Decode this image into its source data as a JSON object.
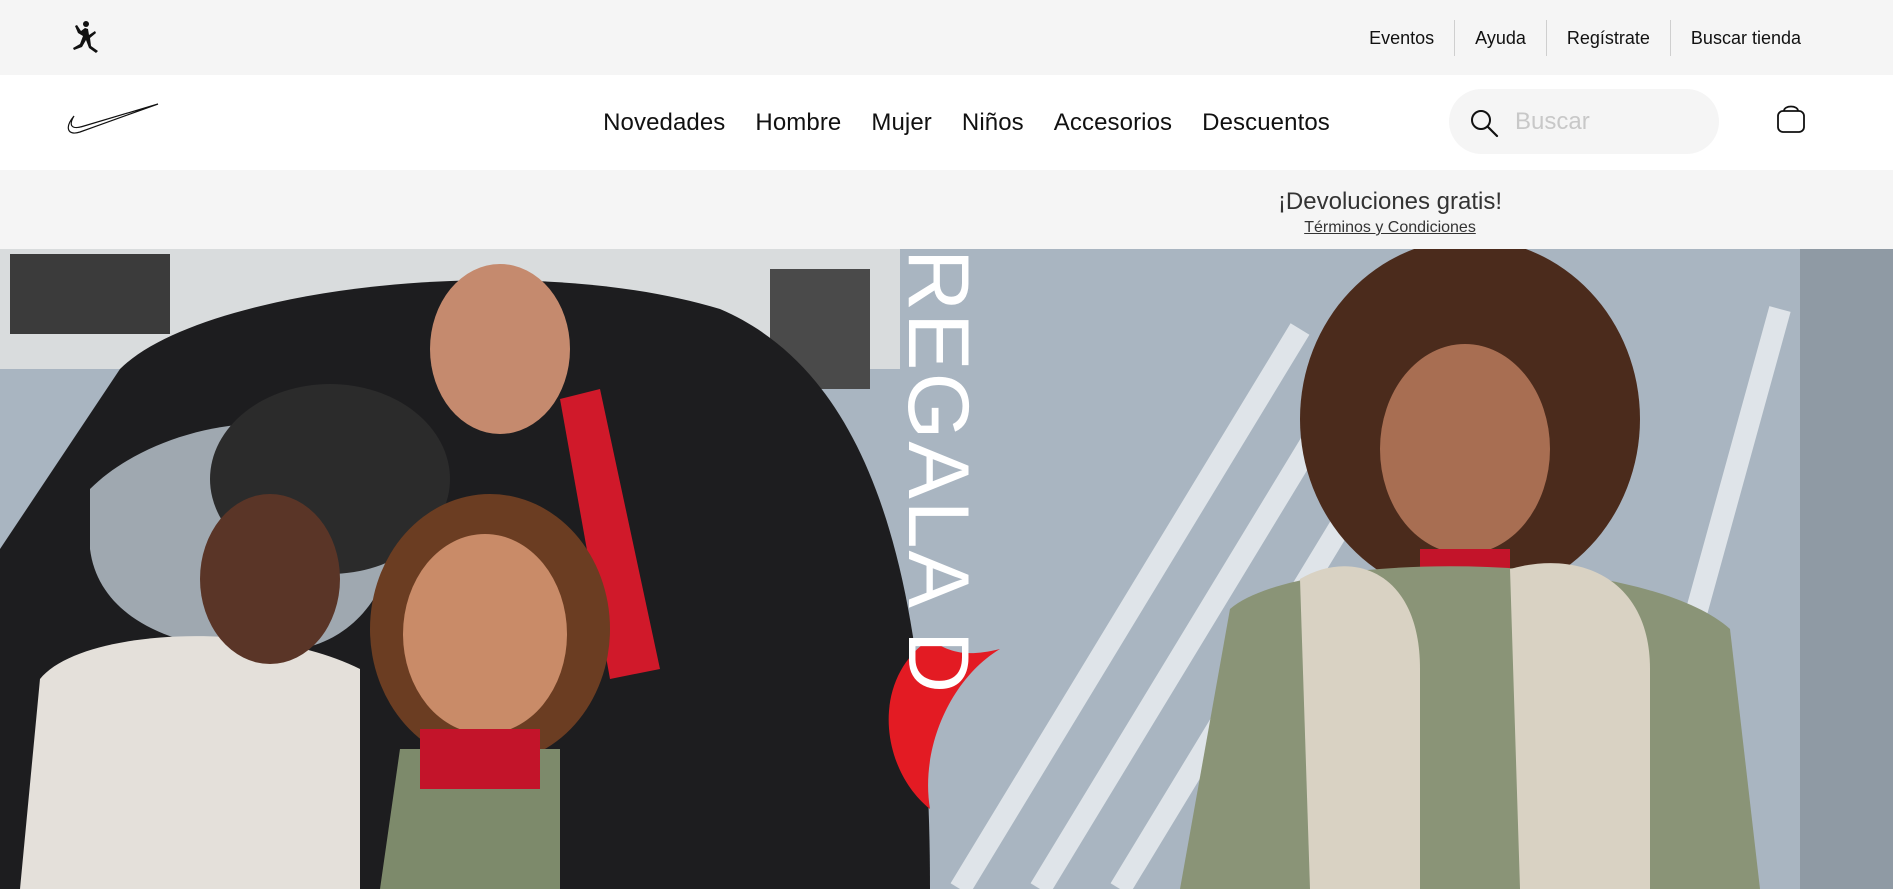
{
  "utility": {
    "logo_icon": "jordan-jumpman-icon",
    "links": [
      "Eventos",
      "Ayuda",
      "Regístrate",
      "Buscar tienda"
    ]
  },
  "nav": {
    "logo_icon": "nike-swoosh-icon",
    "items": [
      "Novedades",
      "Hombre",
      "Mujer",
      "Niños",
      "Accesorios",
      "Descuentos"
    ],
    "search_placeholder": "Buscar",
    "bag_icon": "shopping-bag-icon"
  },
  "promo": {
    "title": "¡Devoluciones gratis!",
    "link": "Términos y Condiciones"
  },
  "hero": {
    "text": "REGALA D",
    "accent_color": "#e31b23"
  }
}
